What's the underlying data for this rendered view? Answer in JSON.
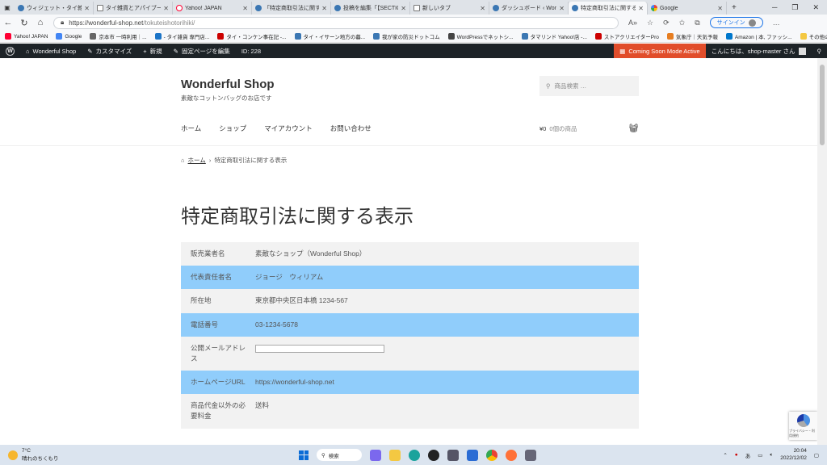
{
  "browser": {
    "tabs": [
      {
        "title": "ウィジェット・タイ雑貨とアパ",
        "icon": "wordpress-icon"
      },
      {
        "title": "タイ雑貨とアパイブーベ吊",
        "icon": "document-icon"
      },
      {
        "title": "Yahoo! JAPAN",
        "icon": "yahoo-icon"
      },
      {
        "title": "「特定商取引法に関する表示",
        "icon": "wordpress-icon"
      },
      {
        "title": "投稿を編集「【SECTION",
        "icon": "wordpress-icon"
      },
      {
        "title": "新しいタブ",
        "icon": "document-icon"
      },
      {
        "title": "ダッシュボード ‹ Wonderful",
        "icon": "wordpress-icon"
      },
      {
        "title": "特定商取引法に関する表",
        "icon": "wordpress-icon"
      },
      {
        "title": "Google",
        "icon": "google-icon"
      }
    ],
    "url_host": "https://wonderful-shop.net",
    "url_path": "/tokuteishotorihiki/",
    "signin_label": "サインイン",
    "bookmarks": [
      "Yahoo! JAPAN",
      "Google",
      "京本市 一時利用｜...",
      "- タイ雑貨 専門店...",
      "タイ・コンケン事在記 -...",
      "タイ・イサーン地方の暮...",
      "我が家の防災ドットコム",
      "WordPressでネットシ...",
      "タマリンド Yahoo!店 -...",
      "ストアクリエイターPro",
      "気象庁｜天気予報",
      "Amazon | 本, ファッシ..."
    ],
    "bookmarks_other": "その他のお気に入り"
  },
  "adminbar": {
    "site": "Wonderful Shop",
    "customize": "カスタマイズ",
    "new": "新規",
    "edit": "固定ページを編集",
    "id": "ID: 228",
    "coming_soon": "Coming Soon Mode Active",
    "greeting": "こんにちは、shop-master さん"
  },
  "site": {
    "title": "Wonderful Shop",
    "description": "素敵なコットンバッグのお店です",
    "search_placeholder": "商品検索 …",
    "menu": [
      "ホーム",
      "ショップ",
      "マイアカウント",
      "お問い合わせ"
    ],
    "cart_price": "¥0",
    "cart_count": "0個の商品"
  },
  "breadcrumb": {
    "home": "ホーム",
    "current": "特定商取引法に関する表示"
  },
  "page_title": "特定商取引法に関する表示",
  "table": [
    {
      "key": "販売業者名",
      "value": "素敵なショップ（Wonderful Shop）"
    },
    {
      "key": "代表責任者名",
      "value": "ジョージ　ウィリアム"
    },
    {
      "key": "所在地",
      "value": "東京都中央区日本橋 1234-567"
    },
    {
      "key": "電話番号",
      "value": "03-1234-5678"
    },
    {
      "key": "公開メールアドレス",
      "value": ""
    },
    {
      "key": "ホームページURL",
      "value": "https://wonderful-shop.net"
    },
    {
      "key": "商品代金以外の必要料金",
      "value": "送料"
    }
  ],
  "recaptcha": "プライバシー・利用規約",
  "taskbar": {
    "weather_temp": "7°C",
    "weather_desc": "晴れのちくもり",
    "search": "検索",
    "ime": "あ",
    "time": "20:04",
    "date": "2022/12/02"
  }
}
